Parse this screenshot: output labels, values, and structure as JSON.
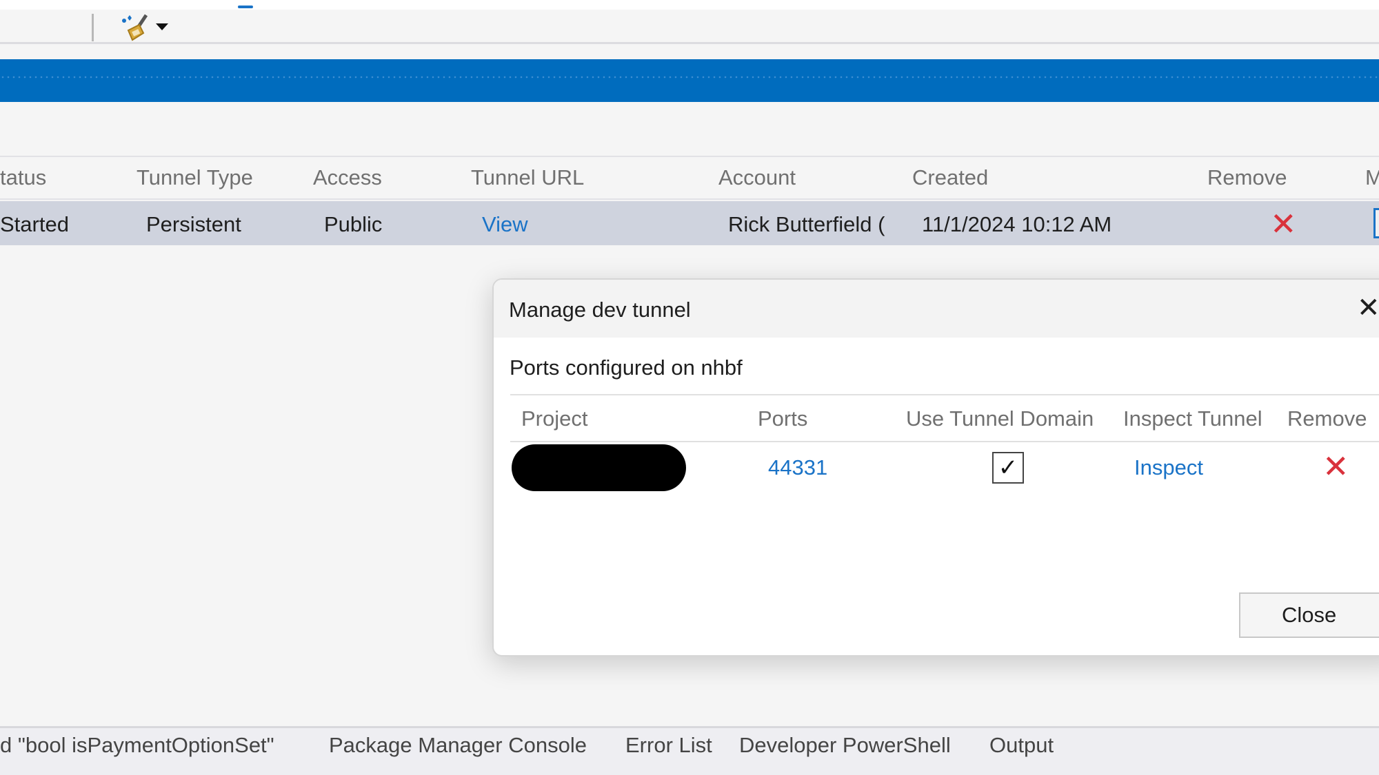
{
  "toolbar": {
    "icons": [
      "clean-brush-icon",
      "dropdown-arrow-icon"
    ]
  },
  "table": {
    "headers": [
      "tatus",
      "Tunnel Type",
      "Access",
      "Tunnel URL",
      "Account",
      "Created",
      "Remove",
      "M"
    ],
    "row": {
      "status": "Started",
      "type": "Persistent",
      "access": "Public",
      "url": "View",
      "account": "Rick Butterfield (",
      "created": "11/1/2024 10:12 AM",
      "remove_icon": "red-x-icon"
    }
  },
  "dialog": {
    "title": "Manage dev tunnel",
    "subtitle": "Ports configured on nhbf",
    "headers": [
      "Project",
      "Ports",
      "Use Tunnel Domain",
      "Inspect Tunnel",
      "Remove"
    ],
    "row": {
      "project": "[redacted]",
      "port": "44331",
      "use_tunnel_domain": true,
      "checkmark": "✓",
      "inspect": "Inspect"
    },
    "close_button": "Close",
    "close_x": "✕"
  },
  "bottom_tabs": [
    "d \"bool isPaymentOptionSet\"",
    "Package Manager Console",
    "Error List",
    "Developer PowerShell",
    "Output"
  ],
  "colors": {
    "accent": "#006cbe",
    "link": "#1a73c7",
    "remove": "#d9323c",
    "selected_row": "#cfd3de"
  }
}
